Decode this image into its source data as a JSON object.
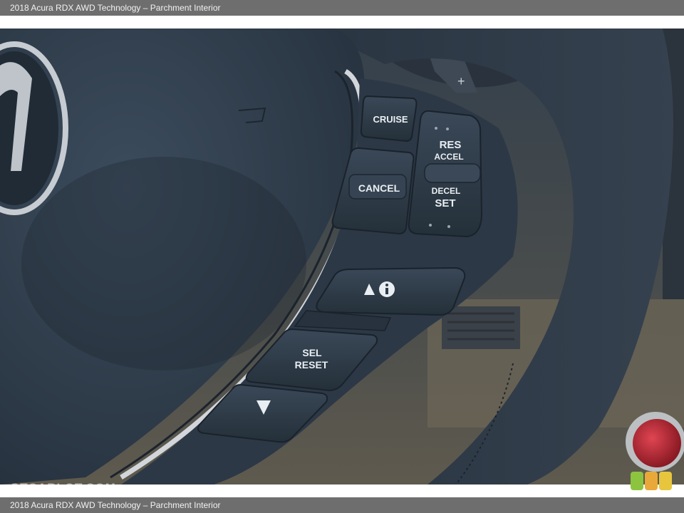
{
  "page": {
    "top_caption": "2018 Acura RDX AWD Technology – Parchment Interior",
    "bottom_caption": "2018 Acura RDX AWD Technology – Parchment Interior"
  },
  "photo": {
    "buttons": {
      "cruise": "CRUISE",
      "cancel": "CANCEL",
      "res": "RES",
      "accel": "ACCEL",
      "decel": "DECEL",
      "set": "SET",
      "sel": "SEL",
      "reset": "RESET"
    },
    "icons": {
      "info": "up-triangle-info-icon",
      "down": "down-triangle-icon"
    },
    "colors": {
      "leather": "#2f3d4c",
      "chrome": "#c9cdd1",
      "button": "#2e3b4a"
    }
  },
  "watermark": {
    "text": "GTCARLOT.COM"
  }
}
